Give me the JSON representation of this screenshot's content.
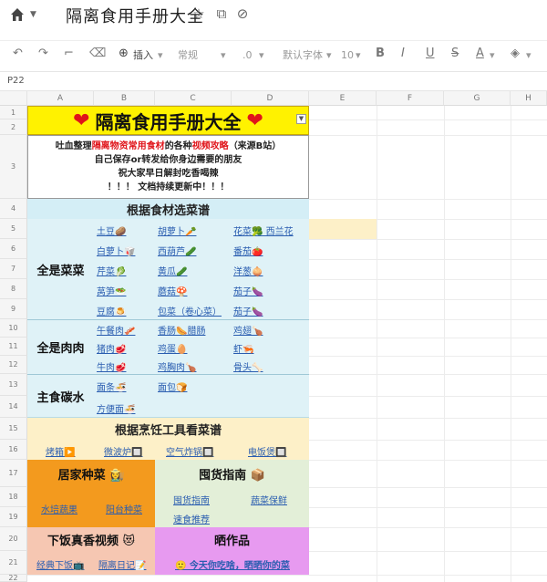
{
  "app": {
    "doc_title": "隔离食用手册大全",
    "cell_ref": "P22"
  },
  "toolbar": {
    "insert_label": "插入",
    "format_label": "常规",
    "decimal_label": ".0",
    "font_label": "默认字体",
    "size_label": "10",
    "bold": "B",
    "italic": "I",
    "underline": "U",
    "strike": "S",
    "font_color": "A"
  },
  "columns": [
    "A",
    "B",
    "C",
    "D",
    "E",
    "F",
    "G",
    "H"
  ],
  "rows": [
    "1",
    "2",
    "3",
    "4",
    "5",
    "6",
    "7",
    "8",
    "9",
    "10",
    "11",
    "12",
    "13",
    "14",
    "15",
    "16",
    "17",
    "18",
    "19",
    "20",
    "21",
    "22"
  ],
  "sheet": {
    "title": "隔离食用手册大全",
    "intro": {
      "line1_a": "吐血整理",
      "line1_b": "隔离物资常用食材",
      "line1_c": "的各种",
      "line1_d": "视频攻略",
      "line1_e": "（来源B站）",
      "line2": "自己保存or转发给你身边需要的朋友",
      "line3": "祝大家早日解封吃香喝辣",
      "line4": "！！！ 文档持续更新中！！！"
    },
    "section_ingredients": "根据食材选菜谱",
    "cat_veg": "全是菜菜",
    "cat_meat": "全是肉肉",
    "cat_staple": "主食碳水",
    "veg_links": [
      [
        "土豆🥔",
        "胡萝卜🥕",
        "花菜🥦 西兰花"
      ],
      [
        "白萝卜🥡",
        "西葫芦🥒",
        "番茄🍅"
      ],
      [
        "芹菜🥬",
        "黄瓜🥒",
        "洋葱🧅"
      ],
      [
        "莴笋🥗",
        "蘑菇🍄",
        "茄子🍆"
      ],
      [
        "豆腐🍮",
        "包菜（卷心菜）",
        "茄子🍆"
      ]
    ],
    "meat_links": [
      [
        "午餐肉🥓",
        "香肠🌭腊肠",
        "鸡翅🍗"
      ],
      [
        "猪肉🥩",
        "鸡蛋🥚",
        "虾🦐"
      ],
      [
        "牛肉🥩",
        "鸡胸肉🍗",
        "骨头🦴"
      ]
    ],
    "staple_links": [
      [
        "面条🍜",
        "面包🍞"
      ],
      [
        "方便面🍜"
      ]
    ],
    "section_tools": "根据烹饪工具看菜谱",
    "tool_links": [
      "烤箱▶️",
      "微波炉🔲",
      "空气炸锅🔲",
      "电饭煲🔲"
    ],
    "home_grow": "居家种菜 👩‍🌾",
    "hoard_guide": "囤货指南 📦",
    "home_links": [
      "水培蔬果",
      "阳台种菜"
    ],
    "hoard_links": [
      "囤货指南",
      "蔬菜保鲜",
      "速食推荐"
    ],
    "video_title": "下饭真香视频 😻",
    "works_title": "晒作品",
    "video_links": [
      "经典下饭📺",
      "隔离日记📝"
    ],
    "works_link": "🙂 今天你吃啥，晒晒你的菜"
  },
  "colors": {
    "title_bg": "#fff200",
    "cyan_bg": "#dff2f7",
    "beige_bg": "#fdf0c8",
    "orange_bg": "#f39a1e",
    "green_bg": "#e3efd8",
    "pink_bg": "#f6c7b2",
    "violet_bg": "#e79af0",
    "link": "#2a5db0",
    "heart": "#e0141a"
  }
}
